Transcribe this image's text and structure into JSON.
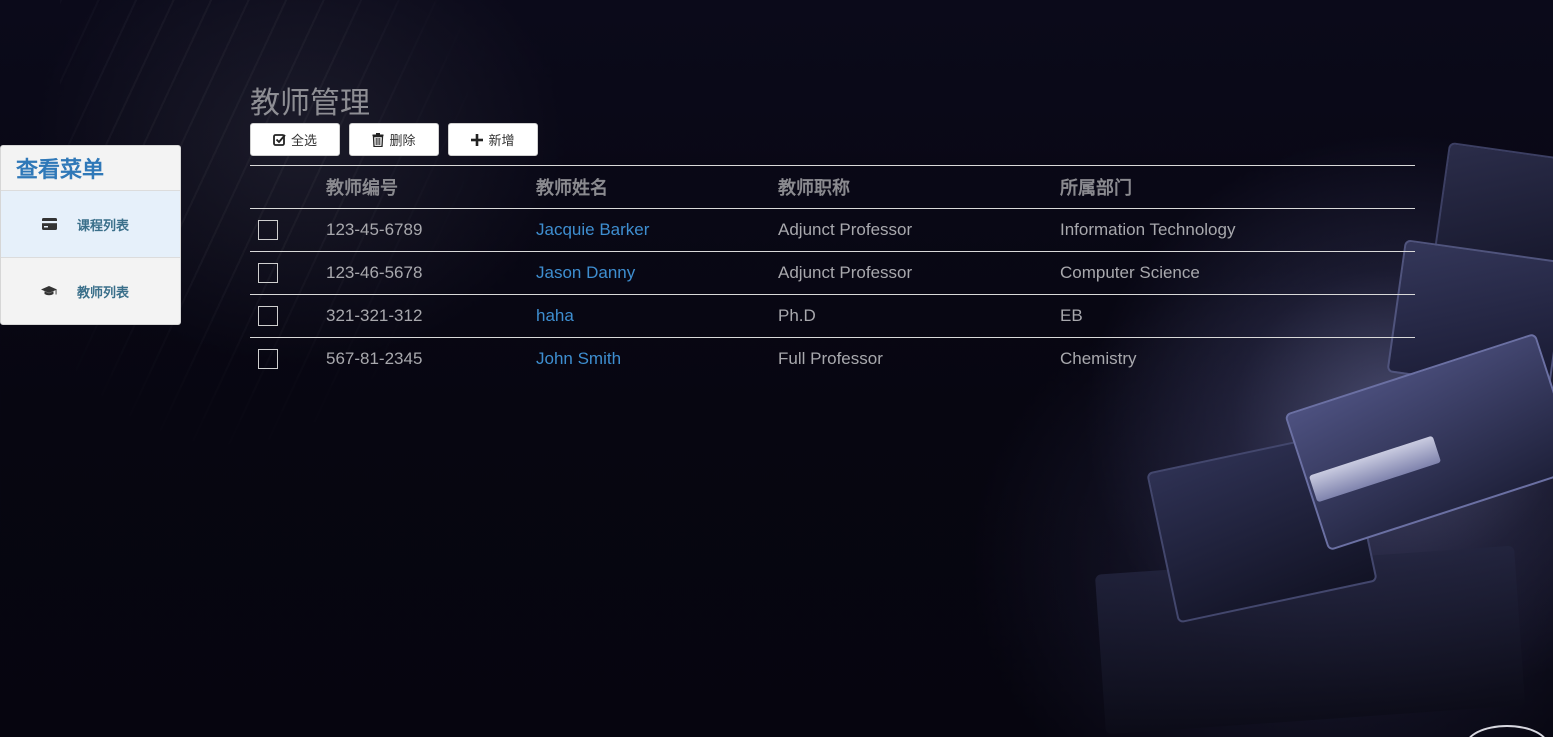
{
  "sidebar": {
    "title": "查看菜单",
    "items": [
      {
        "label": "课程列表",
        "icon": "credit-card-icon",
        "active": true
      },
      {
        "label": "教师列表",
        "icon": "graduation-cap-icon",
        "active": false
      }
    ]
  },
  "main": {
    "title": "教师管理",
    "toolbar": {
      "select_all_label": "全选",
      "delete_label": "删除",
      "add_label": "新增"
    },
    "table": {
      "headers": [
        "教师编号",
        "教师姓名",
        "教师职称",
        "所属部门"
      ],
      "rows": [
        {
          "id": "123-45-6789",
          "name": "Jacquie Barker",
          "title": "Adjunct Professor",
          "dept": "Information Technology"
        },
        {
          "id": "123-46-5678",
          "name": "Jason Danny",
          "title": "Adjunct Professor",
          "dept": "Computer Science"
        },
        {
          "id": "321-321-312",
          "name": "haha",
          "title": "Ph.D",
          "dept": "EB"
        },
        {
          "id": "567-81-2345",
          "name": "John Smith",
          "title": "Full Professor",
          "dept": "Chemistry"
        }
      ]
    }
  },
  "colors": {
    "accent": "#2f78b8",
    "link": "#3e8ed0",
    "background": "#07061a"
  }
}
